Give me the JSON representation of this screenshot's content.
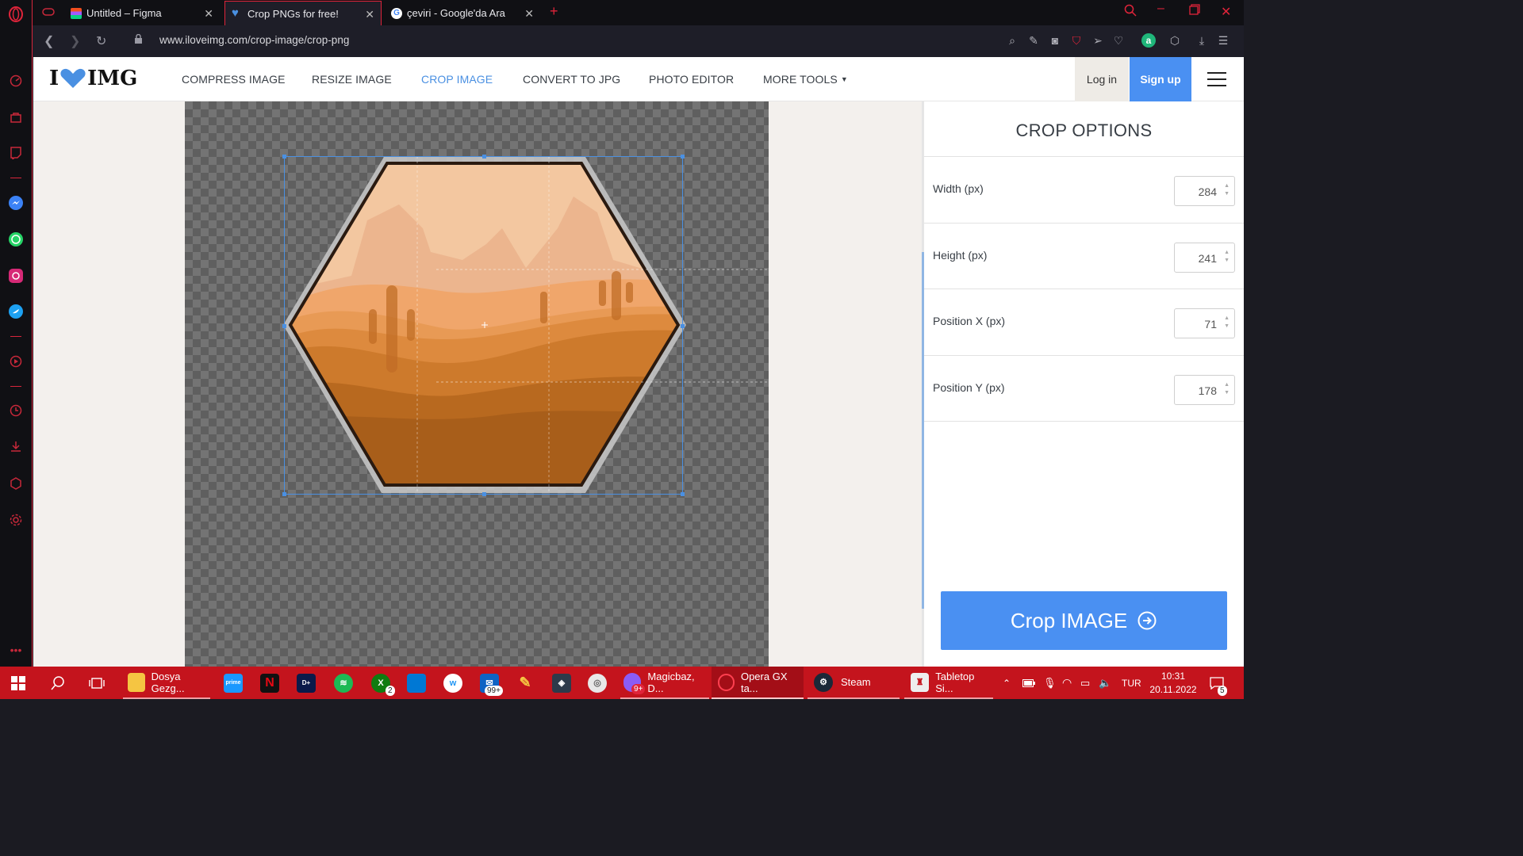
{
  "browser": {
    "tabs": [
      {
        "label": "Untitled – Figma",
        "icon": "figma-icon",
        "active": false
      },
      {
        "label": "Crop PNGs for free!",
        "icon": "iloveimg-heart-icon",
        "active": true
      },
      {
        "label": "çeviri - Google'da Ara",
        "icon": "google-icon",
        "active": false
      }
    ],
    "new_tab": "+",
    "url": "www.iloveimg.com/crop-image/crop-png"
  },
  "site": {
    "logo": {
      "left": "I",
      "right": "IMG"
    },
    "nav": [
      {
        "label": "COMPRESS IMAGE",
        "active": false
      },
      {
        "label": "RESIZE IMAGE",
        "active": false
      },
      {
        "label": "CROP IMAGE",
        "active": true
      },
      {
        "label": "CONVERT TO JPG",
        "active": false
      },
      {
        "label": "PHOTO EDITOR",
        "active": false
      },
      {
        "label": "MORE TOOLS",
        "active": false,
        "dropdown": true
      }
    ],
    "login": "Log in",
    "signup": "Sign up",
    "accent_color": "#4a90f2"
  },
  "crop_panel": {
    "title": "CROP OPTIONS",
    "fields": [
      {
        "label": "Width (px)",
        "value": "284"
      },
      {
        "label": "Height (px)",
        "value": "241"
      },
      {
        "label": "Position X (px)",
        "value": "71"
      },
      {
        "label": "Position Y (px)",
        "value": "178"
      }
    ],
    "submit_label": "Crop IMAGE"
  },
  "taskbar": {
    "items": [
      {
        "label": "Dosya Gezg...",
        "icon": "file-explorer-icon"
      },
      {
        "label": "",
        "icon": "prime-video-icon"
      },
      {
        "label": "",
        "icon": "netflix-icon"
      },
      {
        "label": "",
        "icon": "disney-plus-icon"
      },
      {
        "label": "",
        "icon": "spotify-icon"
      },
      {
        "label": "",
        "icon": "xbox-icon",
        "badge": "2"
      },
      {
        "label": "",
        "icon": "ms-store-icon"
      },
      {
        "label": "",
        "icon": "wattpad-icon"
      },
      {
        "label": "",
        "icon": "mail-icon",
        "badge": "99+"
      },
      {
        "label": "",
        "icon": "pencil-icon"
      },
      {
        "label": "",
        "icon": "davinci-icon"
      },
      {
        "label": "",
        "icon": "swirl-app-icon"
      },
      {
        "label": "Magicbaz, D...",
        "icon": "messenger-icon",
        "badge": "9+"
      },
      {
        "label": "Opera GX ta...",
        "icon": "opera-gx-icon"
      },
      {
        "label": "Steam",
        "icon": "steam-icon"
      },
      {
        "label": "Tabletop Si...",
        "icon": "tabletop-simulator-icon"
      }
    ],
    "language": "TUR",
    "time": "10:31",
    "date": "20.11.2022",
    "notifications": "5"
  }
}
